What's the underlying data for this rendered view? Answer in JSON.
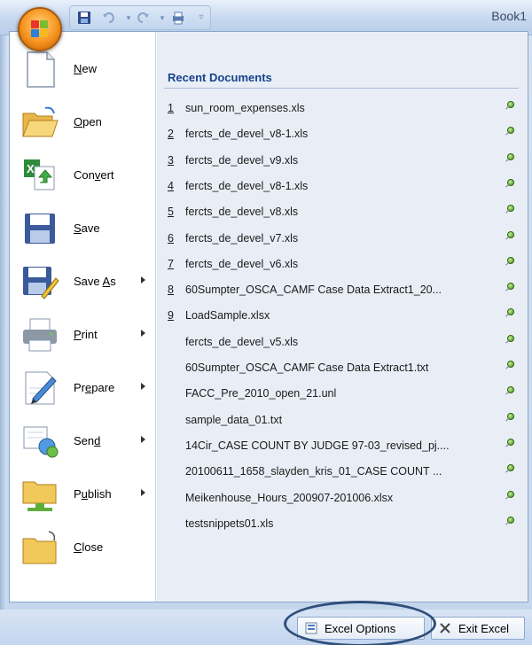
{
  "window": {
    "title": "Book1"
  },
  "quick_access": {
    "icons": [
      "save-icon",
      "undo-icon",
      "redo-icon",
      "print-preview-icon",
      "customize-qat-icon"
    ]
  },
  "office_menu": {
    "commands": [
      {
        "label": "New",
        "mnemonic": "N",
        "icon": "new-document-icon",
        "has_submenu": false
      },
      {
        "label": "Open",
        "mnemonic": "O",
        "icon": "open-folder-icon",
        "has_submenu": false
      },
      {
        "label": "Convert",
        "mnemonic": "v",
        "icon": "convert-icon",
        "has_submenu": false
      },
      {
        "label": "Save",
        "mnemonic": "S",
        "icon": "save-disk-icon",
        "has_submenu": false
      },
      {
        "label": "Save As",
        "mnemonic": "A",
        "icon": "save-as-icon",
        "has_submenu": true
      },
      {
        "label": "Print",
        "mnemonic": "P",
        "icon": "printer-icon",
        "has_submenu": true
      },
      {
        "label": "Prepare",
        "mnemonic": "e",
        "icon": "prepare-pen-icon",
        "has_submenu": true
      },
      {
        "label": "Send",
        "mnemonic": "d",
        "icon": "send-icon",
        "has_submenu": true
      },
      {
        "label": "Publish",
        "mnemonic": "u",
        "icon": "publish-folder-icon",
        "has_submenu": true
      },
      {
        "label": "Close",
        "mnemonic": "C",
        "icon": "close-folder-icon",
        "has_submenu": false
      }
    ],
    "recent": {
      "title": "Recent Documents",
      "items": [
        {
          "num": "1",
          "name": "sun_room_expenses.xls"
        },
        {
          "num": "2",
          "name": "fercts_de_devel_v8-1.xls"
        },
        {
          "num": "3",
          "name": "fercts_de_devel_v9.xls"
        },
        {
          "num": "4",
          "name": "fercts_de_devel_v8-1.xls"
        },
        {
          "num": "5",
          "name": "fercts_de_devel_v8.xls"
        },
        {
          "num": "6",
          "name": "fercts_de_devel_v7.xls"
        },
        {
          "num": "7",
          "name": "fercts_de_devel_v6.xls"
        },
        {
          "num": "8",
          "name": "60Sumpter_OSCA_CAMF Case Data Extract1_20..."
        },
        {
          "num": "9",
          "name": "LoadSample.xlsx"
        },
        {
          "num": "",
          "name": "fercts_de_devel_v5.xls"
        },
        {
          "num": "",
          "name": "60Sumpter_OSCA_CAMF Case Data Extract1.txt"
        },
        {
          "num": "",
          "name": "FACC_Pre_2010_open_21.unl"
        },
        {
          "num": "",
          "name": "sample_data_01.txt"
        },
        {
          "num": "",
          "name": "14Cir_CASE COUNT BY JUDGE 97-03_revised_pj...."
        },
        {
          "num": "",
          "name": "20100611_1658_slayden_kris_01_CASE COUNT ..."
        },
        {
          "num": "",
          "name": "Meikenhouse_Hours_200907-201006.xlsx"
        },
        {
          "num": "",
          "name": "testsnippets01.xls"
        }
      ]
    },
    "footer": {
      "options_label": "Excel Options",
      "exit_label": "Exit Excel"
    }
  },
  "colors": {
    "accent": "#15428b",
    "pin": "#3d8d14",
    "annotation": "#2f4f7a"
  }
}
